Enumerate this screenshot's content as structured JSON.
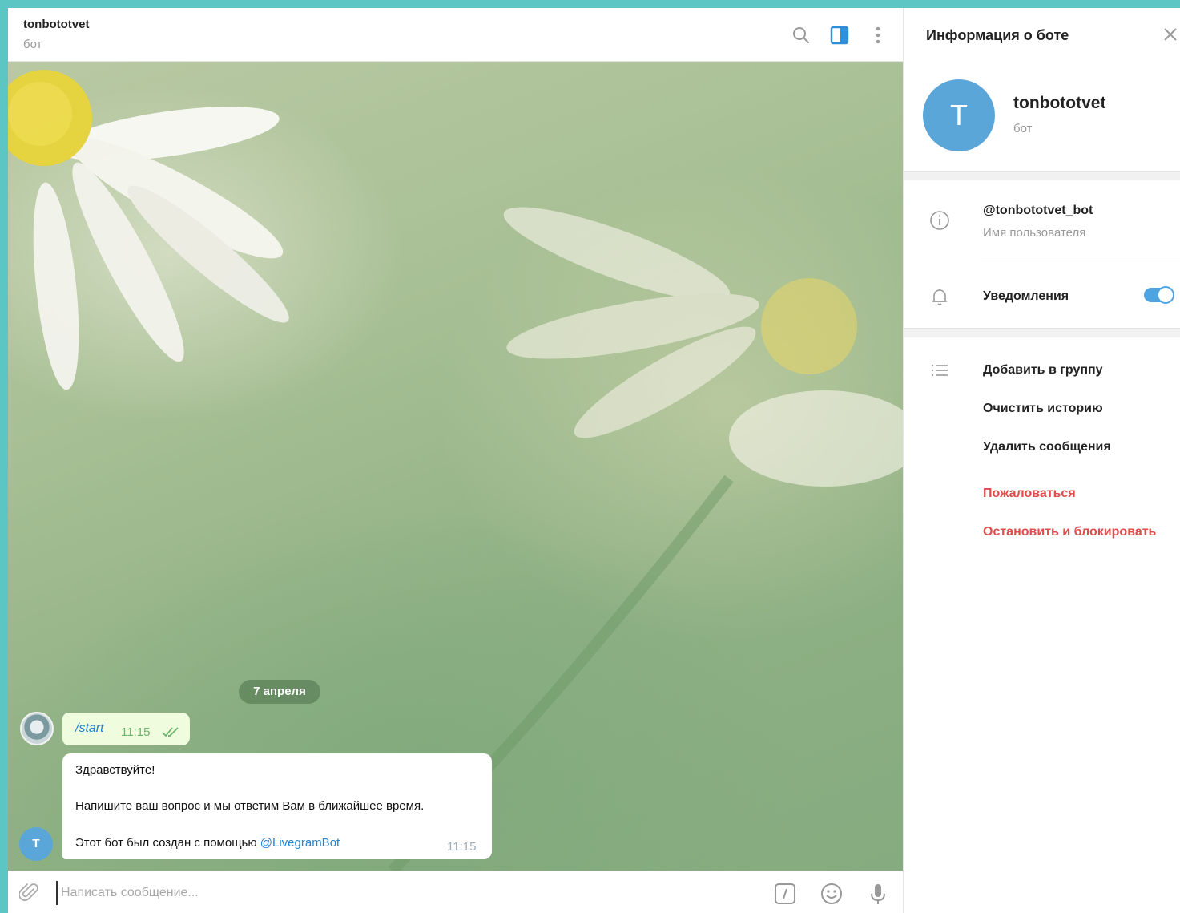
{
  "header": {
    "title": "tonbototvet",
    "subtitle": "бот"
  },
  "chat": {
    "date_pill": "7 апреля",
    "outgoing": {
      "text": "/start",
      "time": "11:15"
    },
    "incoming": {
      "greeting": "Здравствуйте!",
      "body": "Напишите ваш вопрос и мы ответим Вам в ближайшее время.",
      "footer_prefix": "Этот бот был создан с помощью ",
      "footer_link": "@LivegramBot",
      "time": "11:15",
      "avatar_letter": "T"
    }
  },
  "composer": {
    "placeholder": "Написать сообщение..."
  },
  "panel": {
    "title": "Информация о боте",
    "avatar_letter": "T",
    "name": "tonbototvet",
    "subtitle": "бот",
    "username": "@tonbototvet_bot",
    "username_label": "Имя пользователя",
    "notifications_label": "Уведомления",
    "notifications_on": true,
    "actions": [
      "Добавить в группу",
      "Очистить историю",
      "Удалить сообщения"
    ],
    "danger_actions": [
      "Пожаловаться",
      "Остановить и блокировать"
    ]
  },
  "icons": {
    "accent": "#4ea4e0",
    "danger": "#e04b4b",
    "header": [
      "search-icon",
      "sidebar-toggle-icon",
      "more-vertical-icon"
    ],
    "composer": [
      "paperclip-icon",
      "bot-command-icon",
      "emoji-icon",
      "microphone-icon"
    ]
  }
}
